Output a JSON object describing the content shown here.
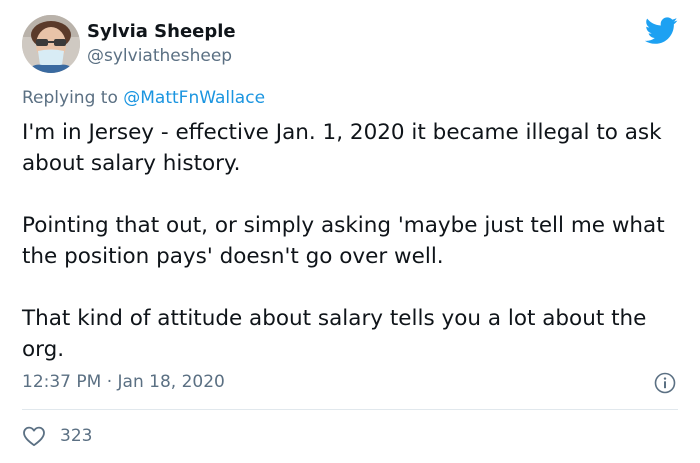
{
  "author": {
    "display_name": "Sylvia Sheeple",
    "handle": "@sylviathesheep"
  },
  "reply": {
    "prefix": "Replying to ",
    "mention": "@MattFnWallace"
  },
  "body": {
    "paragraph_1": "I'm in Jersey - effective Jan. 1, 2020 it became illegal to ask about salary history.",
    "paragraph_2": "Pointing that out, or simply asking 'maybe just tell me what the position pays' doesn't go over well.",
    "paragraph_3": "That kind of attitude about salary tells you a lot about the org."
  },
  "meta": {
    "time": "12:37 PM",
    "separator": " · ",
    "date": "Jan 18, 2020"
  },
  "engagement": {
    "likes": "323"
  },
  "icons": {
    "brand": "twitter-bird-icon",
    "info": "info-icon",
    "like": "heart-icon"
  },
  "colors": {
    "brand_blue": "#1da1f2",
    "link_blue": "#1b95e0",
    "secondary_text": "#5b7083",
    "primary_text": "#0f1419"
  }
}
